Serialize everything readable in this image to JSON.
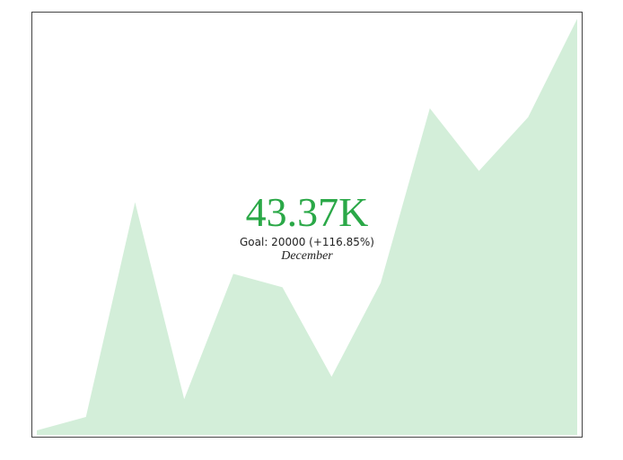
{
  "kpi": {
    "value": "43.37K",
    "goal_text": "Goal: 20000 (+116.85%)",
    "period": "December"
  },
  "colors": {
    "value": "#2aa847",
    "area_fill": "#d3eed9",
    "border": "#444444"
  },
  "chart_data": {
    "type": "area",
    "title": "",
    "xlabel": "",
    "ylabel": "",
    "x": [
      "1",
      "2",
      "3",
      "4",
      "5",
      "6",
      "7",
      "8",
      "9",
      "10",
      "11",
      "12"
    ],
    "series": [
      {
        "values": [
          1000,
          4000,
          52000,
          8000,
          36000,
          33000,
          13000,
          34000,
          73000,
          59000,
          71000,
          93000
        ]
      }
    ],
    "ylim": [
      0,
      94000
    ],
    "grid": false,
    "legend": "none"
  }
}
